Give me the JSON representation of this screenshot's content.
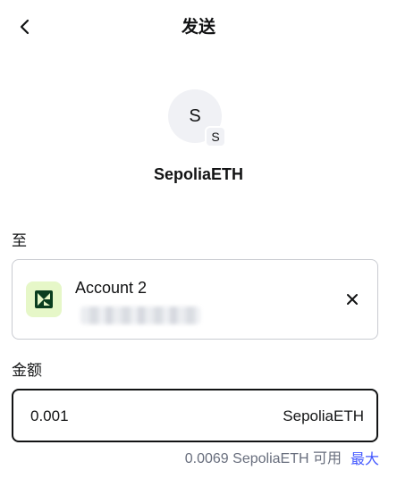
{
  "header": {
    "title": "发送",
    "back_icon": "chevron-left-icon"
  },
  "token": {
    "avatar_letter": "S",
    "network_badge_letter": "S",
    "name": "SepoliaETH"
  },
  "recipient": {
    "label": "至",
    "account_name": "Account 2",
    "avatar_icon": "account-identicon",
    "clear_icon": "close-icon"
  },
  "amount": {
    "label": "金额",
    "value": "0.001",
    "unit": "SepoliaETH"
  },
  "balance": {
    "available_text": "0.0069 SepoliaETH 可用",
    "max_label": "最大"
  },
  "colors": {
    "accent": "#4459ff",
    "text_primary": "#121314",
    "text_muted": "#686e7d",
    "border": "#c9cbd1",
    "avatar_bg": "#f0f1f5",
    "account_avatar_bg": "#e6f7c8",
    "account_avatar_fg": "#0a3d1f"
  }
}
